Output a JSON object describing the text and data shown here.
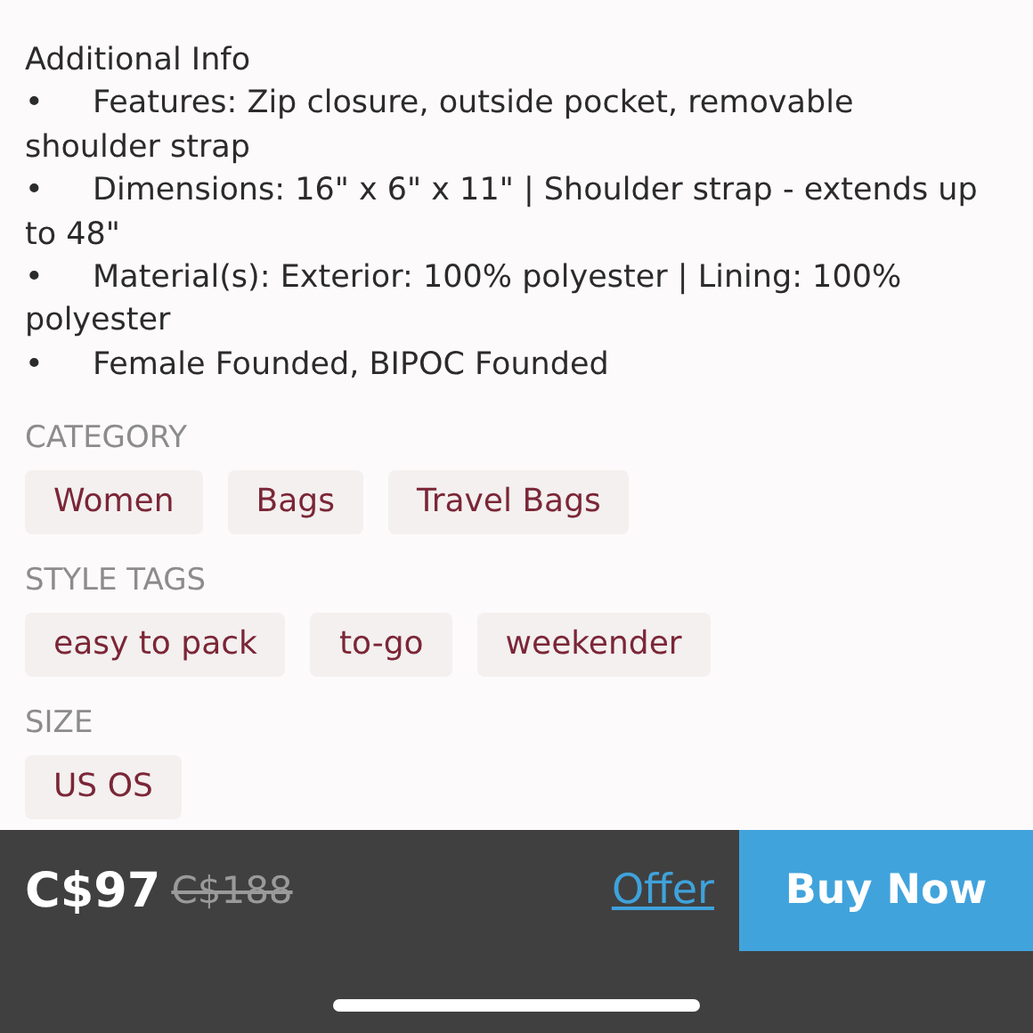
{
  "description": {
    "heading": "Additional Info",
    "bullets": [
      {
        "mark": "•",
        "text": "Features: Zip closure, outside pocket, removable shoulder strap"
      },
      {
        "mark": "•",
        "text": "Dimensions: 16\" x 6\" x 11\" | Shoulder strap - extends up to 48\""
      },
      {
        "mark": "•",
        "text": "Material(s): Exterior: 100% polyester | Lining: 100% polyester"
      },
      {
        "mark": "•",
        "text": "Female Founded, BIPOC Founded"
      }
    ]
  },
  "sections": [
    {
      "title": "CATEGORY",
      "tags": [
        "Women",
        "Bags",
        "Travel Bags"
      ]
    },
    {
      "title": "STYLE TAGS",
      "tags": [
        "easy to pack",
        "to-go",
        "weekender"
      ]
    },
    {
      "title": "SIZE",
      "tags": [
        "US OS"
      ]
    }
  ],
  "bottom_bar": {
    "price": "C$97",
    "original_price": "C$188",
    "offer_link": "Offer",
    "buy_button": "Buy Now"
  }
}
